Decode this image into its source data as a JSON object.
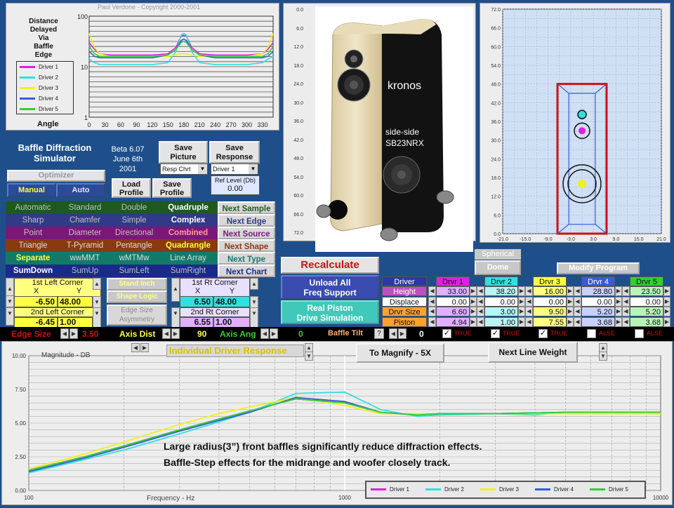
{
  "top_chart": {
    "copyright": "Paul Verdone - Copyright 2000-2001",
    "title_lines": [
      "Distance",
      "Delayed",
      "Via",
      "Baffle",
      "Edge"
    ],
    "y_ticks": [
      "100",
      "10",
      "1"
    ],
    "x_label": "Angle",
    "x_ticks": [
      "0",
      "30",
      "60",
      "90",
      "120",
      "150",
      "180",
      "210",
      "240",
      "270",
      "300",
      "330"
    ],
    "legend": [
      "Driver 1",
      "Driver 2",
      "Driver 3",
      "Driver 4",
      "Driver 5"
    ]
  },
  "colors": {
    "driver1": "#e020e0",
    "driver2": "#30e0e0",
    "driver3": "#f0f020",
    "driver4": "#3a5ad8",
    "driver5": "#30d030"
  },
  "app": {
    "title_line1": "Baffle Diffraction",
    "title_line2": "Simulator",
    "version": "Beta 6.07",
    "date_line1": "June 6th",
    "date_line2": "2001",
    "save_picture": "Save Picture",
    "save_response": "Save Response",
    "resp_select": "Resp Chrt",
    "driver_select": "Driver 1",
    "optimizer": "Optimizer",
    "manual": "Manual",
    "auto": "Auto",
    "load_profile": "Load Profile",
    "save_profile": "Save Profile",
    "ref_level_label": "Ref Level (Db)",
    "ref_level_value": "0.00"
  },
  "shape_grid": [
    [
      {
        "t": "Automatic",
        "bg": "#1e5a1e",
        "fg": "#bfbfbf"
      },
      {
        "t": "Standard",
        "bg": "#1e5a1e",
        "fg": "#bfbfbf"
      },
      {
        "t": "Double",
        "bg": "#1e5a1e",
        "fg": "#bfbfbf"
      },
      {
        "t": "Quadruple",
        "bg": "#1e5a1e",
        "fg": "#ffffff"
      },
      {
        "t": "Next Sample",
        "bg": "#d8d8d8",
        "fg": "#1e5a1e"
      }
    ],
    [
      {
        "t": "Sharp",
        "bg": "#303a86",
        "fg": "#bfbfbf"
      },
      {
        "t": "Chamfer",
        "bg": "#303a86",
        "fg": "#bfbfbf"
      },
      {
        "t": "Simple",
        "bg": "#303a86",
        "fg": "#bfbfbf"
      },
      {
        "t": "Complex",
        "bg": "#303a86",
        "fg": "#ffffff"
      },
      {
        "t": "Next Edge",
        "bg": "#d8d8d8",
        "fg": "#303a86"
      }
    ],
    [
      {
        "t": "Point",
        "bg": "#7a187a",
        "fg": "#bfbfbf"
      },
      {
        "t": "Diameter",
        "bg": "#7a187a",
        "fg": "#bfbfbf"
      },
      {
        "t": "Directional",
        "bg": "#7a187a",
        "fg": "#bfbfbf"
      },
      {
        "t": "Combined",
        "bg": "#7a187a",
        "fg": "#ff9c9c"
      },
      {
        "t": "Next Source",
        "bg": "#d8d8d8",
        "fg": "#7a187a"
      }
    ],
    [
      {
        "t": "Triangle",
        "bg": "#8a3a10",
        "fg": "#dcdcdc"
      },
      {
        "t": "T-Pyramid",
        "bg": "#8a3a10",
        "fg": "#dcdcdc"
      },
      {
        "t": "Pentangle",
        "bg": "#8a3a10",
        "fg": "#dcdcdc"
      },
      {
        "t": "Quadrangle",
        "bg": "#8a3a10",
        "fg": "#ffff40"
      },
      {
        "t": "Next Shape",
        "bg": "#d8d8d8",
        "fg": "#8a3a10"
      }
    ],
    [
      {
        "t": "Separate",
        "bg": "#137a6a",
        "fg": "#ffff40"
      },
      {
        "t": "wwMMT",
        "bg": "#137a6a",
        "fg": "#dcdcdc"
      },
      {
        "t": "wMTMw",
        "bg": "#137a6a",
        "fg": "#dcdcdc"
      },
      {
        "t": "Line Array",
        "bg": "#137a6a",
        "fg": "#dcdcdc"
      },
      {
        "t": "Next Type",
        "bg": "#d8d8d8",
        "fg": "#137a6a"
      }
    ],
    [
      {
        "t": "SumDown",
        "bg": "#1a2a8a",
        "fg": "#ffffff"
      },
      {
        "t": "SumUp",
        "bg": "#1a2a8a",
        "fg": "#bfbfbf"
      },
      {
        "t": "SumLeft",
        "bg": "#1a2a8a",
        "fg": "#bfbfbf"
      },
      {
        "t": "SumRight",
        "bg": "#1a2a8a",
        "fg": "#bfbfbf"
      },
      {
        "t": "Next Chart",
        "bg": "#d8d8d8",
        "fg": "#1a2a8a"
      }
    ]
  ],
  "photo": {
    "label_brand": "kronos",
    "label_config_1": "side-side",
    "label_config_2": "SB23NRX",
    "y_ticks": [
      "0.0",
      "6.0",
      "12.0",
      "18.0",
      "24.0",
      "30.0",
      "36.0",
      "42.0",
      "48.0",
      "54.0",
      "60.0",
      "66.0",
      "72.0"
    ]
  },
  "front_view": {
    "y_ticks": [
      "72.0",
      "66.0",
      "60.0",
      "54.0",
      "48.0",
      "42.0",
      "36.0",
      "30.0",
      "24.0",
      "18.0",
      "12.0",
      "6.0",
      "0.0"
    ],
    "x_ticks": [
      "-21.0",
      "-15.0",
      "-9.0",
      "-3.0",
      "3.0",
      "9.0",
      "15.0",
      "21.0"
    ]
  },
  "corners": {
    "left1_label": "1st Left Corner",
    "left1_x": "-6.50",
    "left1_y": "48.00",
    "left2_label": "2nd Left Corner",
    "left2_x": "-6.45",
    "left2_y": "1.00",
    "right1_label": "1st Rt Corner",
    "right1_x": "6.50",
    "right1_y": "48.00",
    "right2_label": "2nd Rt Corner",
    "right2_x": "6.55",
    "right2_y": "1.00",
    "x_hdr": "X",
    "y_hdr": "Y",
    "stand_inch": "Stand Inch",
    "shape_logic": "Shape Logic",
    "edge_size_asym_1": "Edge Size",
    "edge_size_asym_2": "Asymmetry"
  },
  "actions": {
    "recalculate": "Recalculate",
    "unload_1": "Unload All",
    "unload_2": "Freq Support",
    "piston_1": "Real Piston",
    "piston_2": "Drive Simulation",
    "spherical": "Spherical",
    "dome": "Dome",
    "modify_program": "Modify Program"
  },
  "driver_table": {
    "row_labels": [
      "Driver",
      "Height",
      "Displace",
      "Drvr Size",
      "Piston"
    ],
    "columns": [
      {
        "name": "Drvr 1",
        "height": "33.00",
        "displace": "0.00",
        "size": "6.60",
        "piston": "4.94"
      },
      {
        "name": "Drvr 2",
        "height": "38.20",
        "displace": "0.00",
        "size": "3.00",
        "piston": "1.00"
      },
      {
        "name": "Drvr 3",
        "height": "16.00",
        "displace": "0.00",
        "size": "9.50",
        "piston": "7.55"
      },
      {
        "name": "Drvr 4",
        "height": "28.80",
        "displace": "0.00",
        "size": "5.20",
        "piston": "3.68"
      },
      {
        "name": "Drvr 5",
        "height": "23.50",
        "displace": "0.00",
        "size": "5.20",
        "piston": "3.68"
      }
    ]
  },
  "status_bar": {
    "edge_size_label": "Edge Size",
    "edge_size_value": "3.50",
    "axis_dist_label": "Axis Dist",
    "axis_dist_value": "90",
    "axis_ang_label": "Axis Ang",
    "axis_ang_value": "0",
    "baffle_tilt_label": "Baffle Tilt",
    "baffle_tilt_q": "?",
    "baffle_tilt_value": "0",
    "checks": [
      {
        "label": "TRUE",
        "checked": true
      },
      {
        "label": "TRUE",
        "checked": true
      },
      {
        "label": "TRUE",
        "checked": true
      },
      {
        "label": "ALSE",
        "checked": false
      },
      {
        "label": "ALSE",
        "checked": false
      }
    ]
  },
  "bottom_chart": {
    "title": "Individual Driver Response",
    "ylabel": "Magnitude - DB",
    "xlabel": "Frequency - Hz",
    "magnify": "To Magnify - 5X",
    "next_line": "Next Line Weight",
    "annotation_1": "Large radius(3”) front baffles significantly reduce diffraction effects.",
    "annotation_2": "Baffle-Step effects for the midrange and woofer closely track.",
    "y_ticks": [
      "10.00",
      "7.50",
      "5.00",
      "2.50",
      "0.00"
    ],
    "x_ticks": [
      "100",
      "1000",
      "10000"
    ]
  },
  "chart_data": [
    {
      "type": "line",
      "title": "Distance Delayed Via Baffle Edge",
      "xlabel": "Angle",
      "ylabel": "",
      "ylim": [
        1,
        100
      ],
      "xlim": [
        0,
        350
      ],
      "yscale": "log",
      "series": [
        {
          "name": "Driver 1",
          "x": [
            0,
            10,
            20,
            40,
            60,
            90,
            120,
            150,
            165,
            175,
            180,
            185,
            195,
            210,
            240,
            270,
            300,
            330,
            340,
            350
          ],
          "y": [
            30,
            22,
            18,
            17,
            17,
            17,
            17,
            18,
            24,
            40,
            42,
            40,
            24,
            18,
            17,
            17,
            17,
            18,
            22,
            30
          ]
        },
        {
          "name": "Driver 2",
          "x": [
            0,
            10,
            20,
            40,
            60,
            90,
            120,
            150,
            165,
            175,
            180,
            185,
            195,
            210,
            240,
            270,
            300,
            330,
            340,
            350
          ],
          "y": [
            14,
            12,
            11,
            11,
            11,
            11,
            11,
            12,
            20,
            42,
            46,
            42,
            20,
            12,
            11,
            11,
            11,
            12,
            14,
            16
          ]
        },
        {
          "name": "Driver 3",
          "x": [
            0,
            10,
            20,
            40,
            60,
            90,
            120,
            150,
            165,
            175,
            180,
            185,
            195,
            210,
            240,
            270,
            300,
            330,
            340,
            350
          ],
          "y": [
            45,
            24,
            18,
            16,
            16,
            16,
            16,
            16,
            17,
            18,
            18,
            18,
            17,
            16,
            16,
            16,
            16,
            18,
            24,
            45
          ]
        },
        {
          "name": "Driver 4",
          "x": [
            0,
            10,
            20,
            40,
            60,
            90,
            120,
            150,
            165,
            175,
            180,
            185,
            195,
            210,
            240,
            270,
            300,
            330,
            340,
            350
          ],
          "y": [
            20,
            16,
            15,
            15,
            15,
            15,
            15,
            17,
            22,
            33,
            35,
            33,
            22,
            17,
            15,
            15,
            15,
            15,
            16,
            20
          ]
        },
        {
          "name": "Driver 5",
          "x": [
            0,
            10,
            20,
            40,
            60,
            90,
            120,
            150,
            165,
            175,
            180,
            185,
            195,
            210,
            240,
            270,
            300,
            330,
            340,
            350
          ],
          "y": [
            25,
            18,
            16,
            16,
            16,
            16,
            16,
            17,
            22,
            30,
            32,
            30,
            22,
            17,
            16,
            16,
            16,
            16,
            18,
            25
          ]
        }
      ]
    },
    {
      "type": "line",
      "title": "Individual Driver Response",
      "xlabel": "Frequency - Hz",
      "ylabel": "Magnitude - DB",
      "ylim": [
        0,
        10
      ],
      "xlim": [
        100,
        10000
      ],
      "xscale": "log",
      "series": [
        {
          "name": "Driver 1",
          "x": [
            100,
            150,
            200,
            300,
            400,
            500,
            700,
            1000,
            1300,
            1700,
            2000,
            3000,
            5000,
            7000,
            10000
          ],
          "y": [
            1.5,
            2.5,
            3.3,
            4.5,
            5.3,
            5.9,
            6.8,
            6.5,
            5.8,
            5.6,
            5.7,
            5.7,
            5.8,
            5.8,
            5.8
          ]
        },
        {
          "name": "Driver 2",
          "x": [
            100,
            150,
            200,
            300,
            400,
            500,
            700,
            1000,
            1300,
            1700,
            2000,
            3000,
            4000,
            5000,
            7000,
            10000
          ],
          "y": [
            1.3,
            2.3,
            3.0,
            4.2,
            5.1,
            5.8,
            7.2,
            7.3,
            6.0,
            5.5,
            5.6,
            5.7,
            5.6,
            5.8,
            5.8,
            5.8
          ]
        },
        {
          "name": "Driver 3",
          "x": [
            100,
            150,
            200,
            300,
            400,
            500,
            700,
            1000,
            1300,
            1700,
            2000,
            3000,
            5000,
            7000,
            10000
          ],
          "y": [
            1.6,
            2.7,
            3.6,
            4.9,
            5.7,
            6.2,
            6.9,
            6.3,
            5.7,
            5.7,
            5.7,
            5.7,
            5.7,
            5.7,
            5.7
          ]
        },
        {
          "name": "Driver 4",
          "x": [
            100,
            150,
            200,
            300,
            400,
            500,
            700,
            1000,
            1300,
            1700,
            2000,
            3000,
            5000,
            7000,
            10000
          ],
          "y": [
            1.4,
            2.4,
            3.2,
            4.4,
            5.2,
            5.8,
            6.9,
            6.6,
            5.8,
            5.6,
            5.7,
            5.7,
            5.8,
            5.8,
            5.8
          ]
        },
        {
          "name": "Driver 5",
          "x": [
            100,
            150,
            200,
            300,
            400,
            500,
            700,
            1000,
            1300,
            1700,
            2000,
            3000,
            5000,
            7000,
            10000
          ],
          "y": [
            1.5,
            2.5,
            3.3,
            4.5,
            5.3,
            5.9,
            6.8,
            6.5,
            5.8,
            5.6,
            5.7,
            5.7,
            5.8,
            5.8,
            5.8
          ]
        }
      ]
    }
  ]
}
